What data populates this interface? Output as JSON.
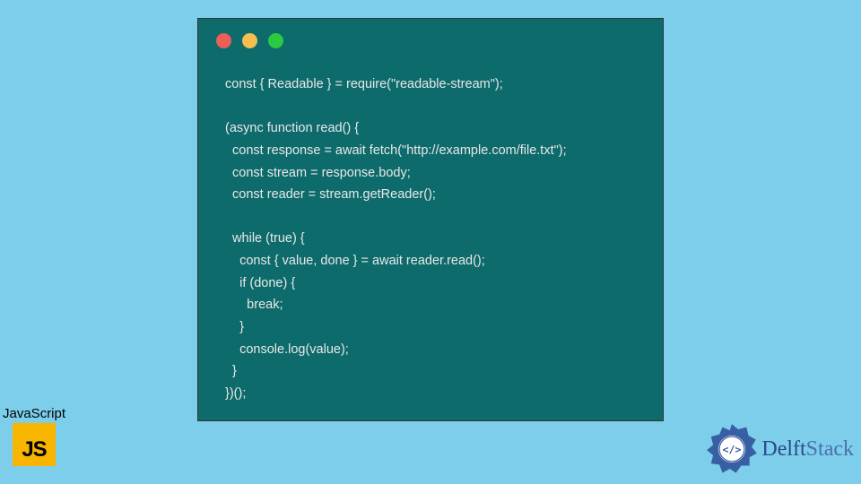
{
  "colors": {
    "background": "#7dceeb",
    "window_bg": "#0e6b6b",
    "code_text": "#e8e8e8",
    "dot_red": "#ec5f59",
    "dot_yellow": "#f5be4f",
    "dot_green": "#2bca41",
    "js_bg": "#f7b500",
    "delft_primary": "#2c4a8a"
  },
  "code": {
    "lines": "const { Readable } = require(\"readable-stream\");\n\n(async function read() {\n  const response = await fetch(\"http://example.com/file.txt\");\n  const stream = response.body;\n  const reader = stream.getReader();\n\n  while (true) {\n    const { value, done } = await reader.read();\n    if (done) {\n      break;\n    }\n    console.log(value);\n  }\n})();"
  },
  "js_badge": {
    "label": "JavaScript",
    "icon_text": "JS"
  },
  "delft_badge": {
    "text_delft": "Delft",
    "text_stack": "Stack"
  }
}
